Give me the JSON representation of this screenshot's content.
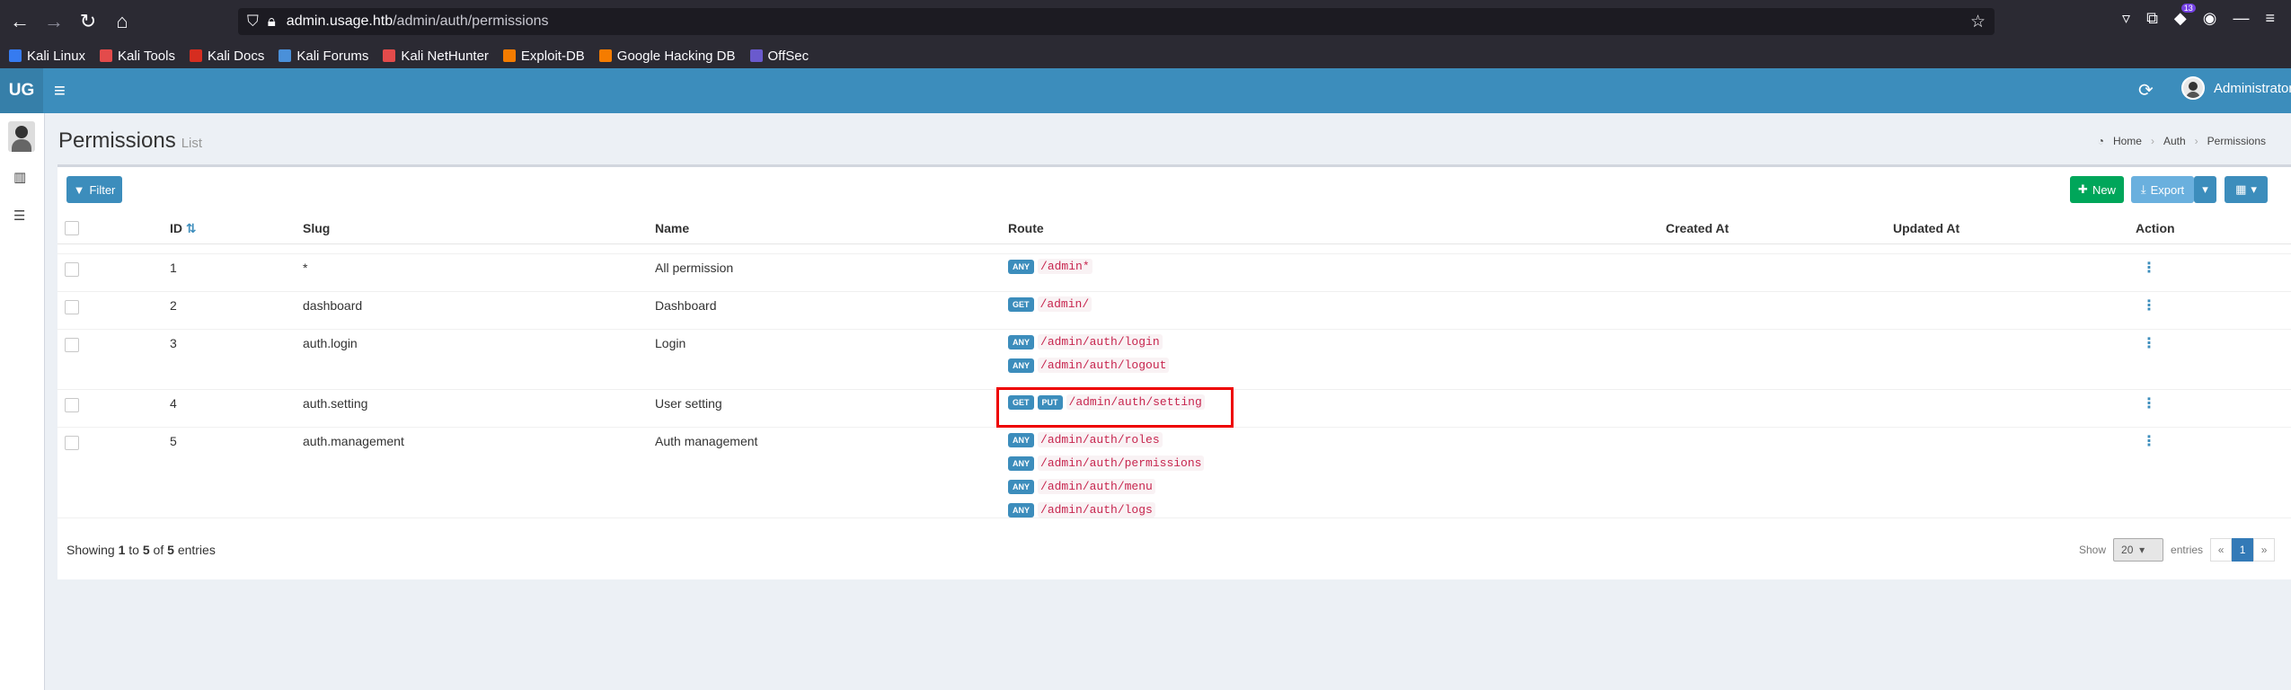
{
  "browser": {
    "url_host": "admin.usage.htb",
    "url_path": "/admin/auth/permissions",
    "ext_count": "13"
  },
  "bookmarks": [
    {
      "label": "Kali Linux",
      "color": "#367bf0"
    },
    {
      "label": "Kali Tools",
      "color": "#e34b4b"
    },
    {
      "label": "Kali Docs",
      "color": "#d62d20"
    },
    {
      "label": "Kali Forums",
      "color": "#4a90d9"
    },
    {
      "label": "Kali NetHunter",
      "color": "#e34b4b"
    },
    {
      "label": "Exploit-DB",
      "color": "#f57c00"
    },
    {
      "label": "Google Hacking DB",
      "color": "#f57c00"
    },
    {
      "label": "OffSec",
      "color": "#6a5acd"
    }
  ],
  "header": {
    "logo": "UG",
    "user": "Administrator"
  },
  "page": {
    "title": "Permissions",
    "subtitle": "List",
    "breadcrumb": [
      "Home",
      "Auth",
      "Permissions"
    ]
  },
  "toolbar": {
    "filter": "Filter",
    "new": "New",
    "export": "Export"
  },
  "table": {
    "columns": {
      "id": "ID",
      "slug": "Slug",
      "name": "Name",
      "route": "Route",
      "created_at": "Created At",
      "updated_at": "Updated At",
      "action": "Action"
    },
    "rows": [
      {
        "id": "1",
        "slug": "*",
        "name": "All permission",
        "routes": [
          {
            "methods": [
              "ANY"
            ],
            "path": "/admin*"
          }
        ]
      },
      {
        "id": "2",
        "slug": "dashboard",
        "name": "Dashboard",
        "routes": [
          {
            "methods": [
              "GET"
            ],
            "path": "/admin/"
          }
        ]
      },
      {
        "id": "3",
        "slug": "auth.login",
        "name": "Login",
        "routes": [
          {
            "methods": [
              "ANY"
            ],
            "path": "/admin/auth/login"
          },
          {
            "methods": [
              "ANY"
            ],
            "path": "/admin/auth/logout"
          }
        ]
      },
      {
        "id": "4",
        "slug": "auth.setting",
        "name": "User setting",
        "routes": [
          {
            "methods": [
              "GET",
              "PUT"
            ],
            "path": "/admin/auth/setting"
          }
        ]
      },
      {
        "id": "5",
        "slug": "auth.management",
        "name": "Auth management",
        "routes": [
          {
            "methods": [
              "ANY"
            ],
            "path": "/admin/auth/roles"
          },
          {
            "methods": [
              "ANY"
            ],
            "path": "/admin/auth/permissions"
          },
          {
            "methods": [
              "ANY"
            ],
            "path": "/admin/auth/menu"
          },
          {
            "methods": [
              "ANY"
            ],
            "path": "/admin/auth/logs"
          }
        ]
      }
    ]
  },
  "footer": {
    "showing_prefix": "Showing",
    "from": "1",
    "to_word": "to",
    "to": "5",
    "of_word": "of",
    "total": "5",
    "entries_word": "entries",
    "show_label": "Show",
    "per_page": "20",
    "entries_label": "entries",
    "prev": "«",
    "page": "1",
    "next": "»"
  }
}
